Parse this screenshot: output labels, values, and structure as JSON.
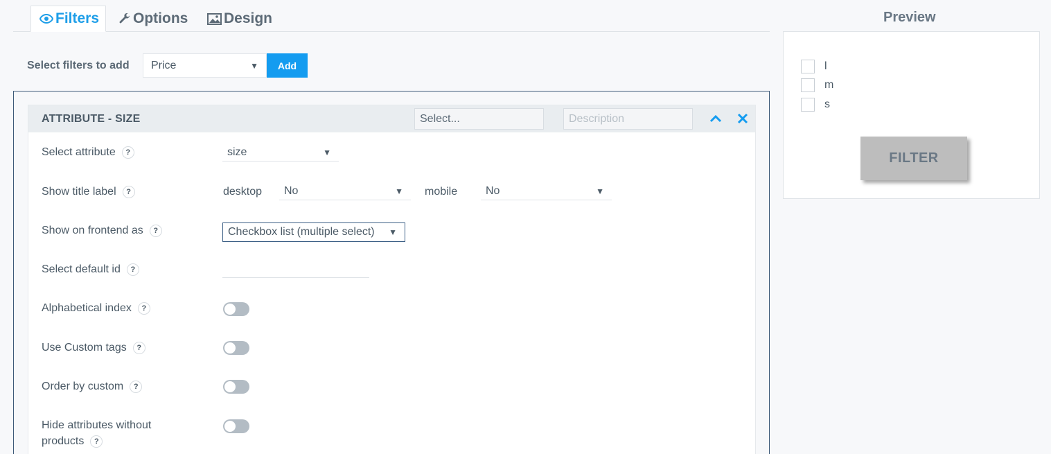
{
  "tabs": [
    {
      "label": "Filters",
      "icon": "eye-icon",
      "active": true
    },
    {
      "label": "Options",
      "icon": "wrench-icon"
    },
    {
      "label": "Design",
      "icon": "image-icon"
    }
  ],
  "add_filter": {
    "label": "Select filters to add",
    "selected": "Price",
    "button": "Add"
  },
  "card": {
    "title": "ATTRIBUTE - SIZE",
    "select_placeholder": "Select...",
    "description_placeholder": "Description",
    "rows": {
      "select_attribute": {
        "label": "Select attribute",
        "value": "size"
      },
      "show_title_label": {
        "label": "Show title label",
        "desktop_label": "desktop",
        "desktop_value": "No",
        "mobile_label": "mobile",
        "mobile_value": "No"
      },
      "show_frontend": {
        "label": "Show on frontend as",
        "value": "Checkbox list (multiple select)"
      },
      "default_id": {
        "label": "Select default id",
        "value": ""
      },
      "alpha_index": {
        "label": "Alphabetical index",
        "on": false
      },
      "custom_tags": {
        "label": "Use Custom tags",
        "on": false
      },
      "order_custom": {
        "label": "Order by custom",
        "on": false
      },
      "hide_attrs": {
        "label_line1": "Hide attributes without",
        "label_line2": "products",
        "on": false
      }
    },
    "help_glyph": "?"
  },
  "preview": {
    "title": "Preview",
    "options": [
      "l",
      "m",
      "s"
    ],
    "button": "FILTER"
  },
  "colors": {
    "accent": "#149cf0",
    "tab_active": "#1d9ee8",
    "panel_border": "#3d5a78"
  }
}
